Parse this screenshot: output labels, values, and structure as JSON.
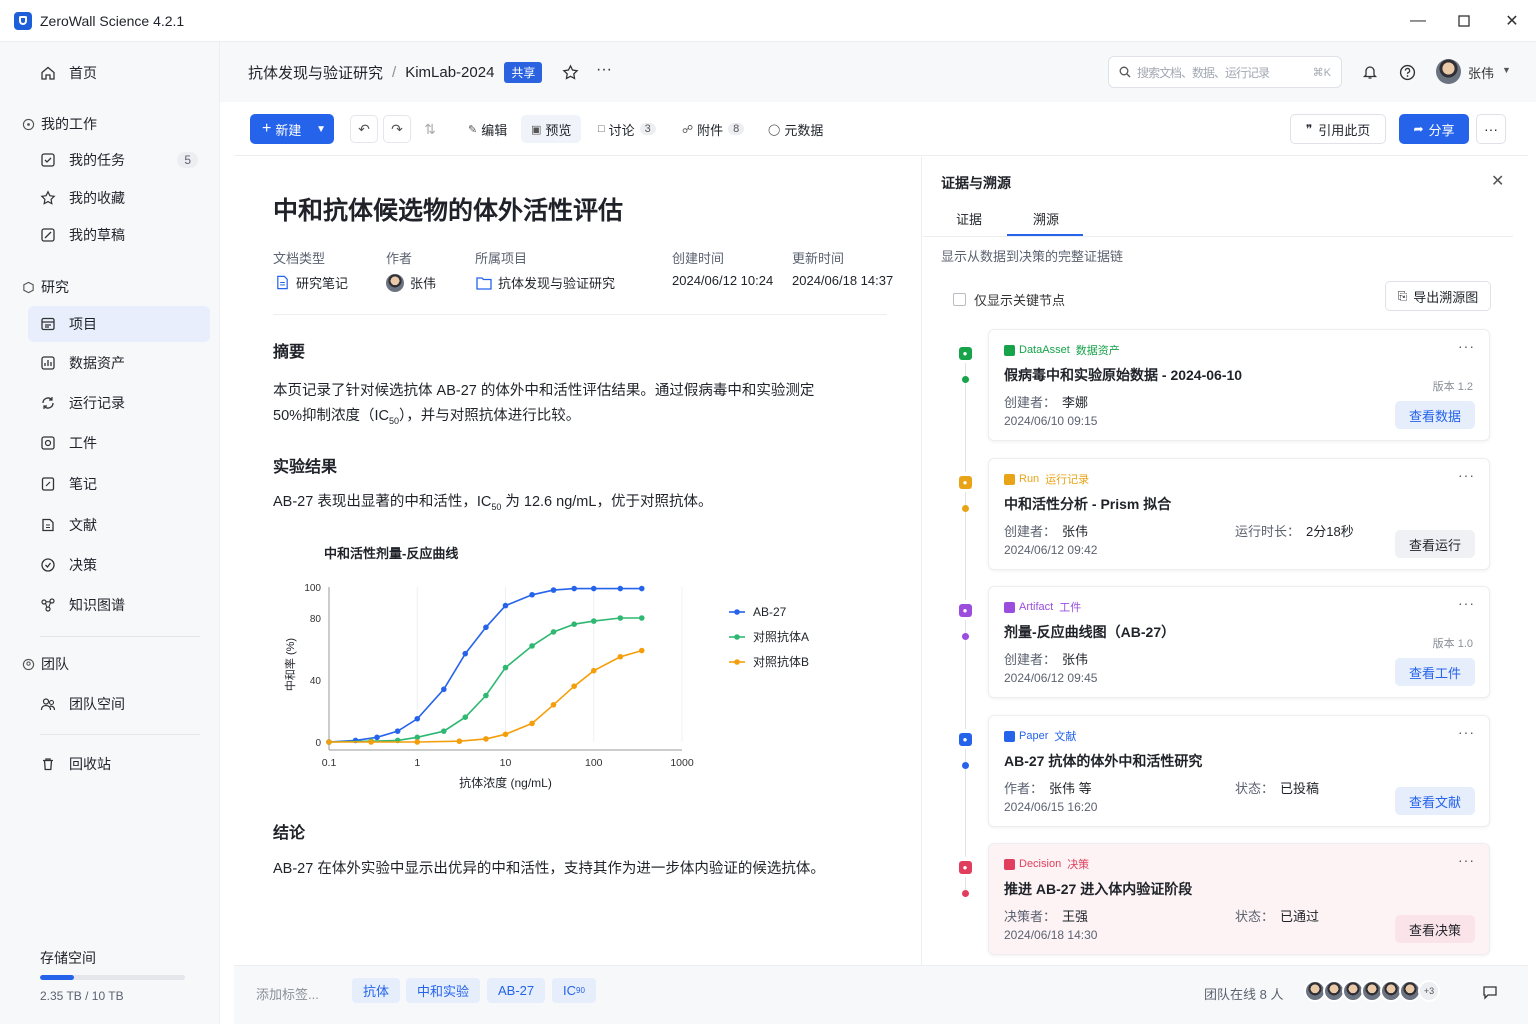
{
  "app": {
    "title": "ZeroWall Science 4.2.1"
  },
  "sidebar": {
    "home": "首页",
    "my_work": "我的工作",
    "my_work_items": [
      {
        "label": "我的任务",
        "count": "5"
      },
      {
        "label": "我的收藏"
      },
      {
        "label": "我的草稿"
      }
    ],
    "research": "研究",
    "research_items": [
      {
        "label": "项目"
      },
      {
        "label": "数据资产"
      },
      {
        "label": "运行记录"
      },
      {
        "label": "工件"
      },
      {
        "label": "笔记"
      },
      {
        "label": "文献"
      },
      {
        "label": "决策"
      },
      {
        "label": "知识图谱"
      }
    ],
    "team": "团队",
    "team_space": "团队空间",
    "trash": "回收站",
    "storage": {
      "label": "存储空间",
      "used_fraction": 0.235,
      "text": "2.35 TB / 10 TB"
    }
  },
  "header": {
    "project": "抗体发现与验证研究",
    "separator": "/",
    "lab": "KimLab-2024",
    "shared_badge": "共享",
    "search_placeholder": "搜索文档、数据、运行记录",
    "search_shortcut": "⌘K",
    "user": "张伟"
  },
  "toolbar": {
    "new_label": "新建",
    "tabs": [
      {
        "label": "编辑"
      },
      {
        "label": "预览"
      },
      {
        "label": "讨论",
        "count": "3"
      },
      {
        "label": "附件",
        "count": "8"
      },
      {
        "label": "元数据"
      }
    ],
    "cite_label": "引用此页",
    "share_label": "分享"
  },
  "doc": {
    "title": "中和抗体候选物的体外活性评估",
    "meta": {
      "type_label": "文档类型",
      "type_value": "研究笔记",
      "author_label": "作者",
      "author_value": "张伟",
      "project_label": "所属项目",
      "project_value": "抗体发现与验证研究",
      "created_label": "创建时间",
      "created_value": "2024/06/12 10:24",
      "updated_label": "更新时间",
      "updated_value": "2024/06/18 14:37"
    },
    "abstract_heading": "摘要",
    "abstract_p1": "本页记录了针对候选抗体 AB-27 的体外中和活性评估结果。通过假病毒中和实验测定",
    "abstract_p2_a": "50%抑制浓度（IC",
    "abstract_p2_sub": "50",
    "abstract_p2_b": "），并与对照抗体进行比较。",
    "results_heading": "实验结果",
    "results_a": "AB-27 表现出显著的中和活性，IC",
    "results_sub": "50",
    "results_b": " 为 12.6 ng/mL，优于对照抗体。",
    "conclusion_heading": "结论",
    "conclusion_text": "AB-27 在体外实验中显示出优异的中和活性，支持其作为进一步体内验证的候选抗体。"
  },
  "chart_data": {
    "type": "line",
    "title": "中和活性剂量-反应曲线",
    "xlabel": "抗体浓度 (ng/mL)",
    "ylabel": "中和率 (%)",
    "x_scale": "log",
    "xlim": [
      0.1,
      1000
    ],
    "ylim": [
      0,
      100
    ],
    "x_ticks": [
      "0.1",
      "1",
      "10",
      "100",
      "1000"
    ],
    "y_ticks": [
      "0",
      "40",
      "80",
      "100"
    ],
    "legend_position": "right",
    "grid": true,
    "series": [
      {
        "name": "AB-27",
        "color": "#2563eb",
        "x": [
          0.1,
          0.2,
          0.35,
          0.6,
          1,
          2,
          3.5,
          6,
          10,
          20,
          35,
          60,
          100,
          200,
          350
        ],
        "y": [
          0,
          1,
          3,
          7,
          15,
          34,
          57,
          74,
          88,
          95,
          98,
          99,
          99,
          99,
          99
        ]
      },
      {
        "name": "对照抗体A",
        "color": "#2eb872",
        "x": [
          0.1,
          0.3,
          0.6,
          1,
          2,
          3.5,
          6,
          10,
          20,
          35,
          60,
          100,
          200,
          350
        ],
        "y": [
          0,
          0.5,
          1,
          3,
          7,
          16,
          30,
          48,
          62,
          71,
          76,
          78,
          80,
          80
        ]
      },
      {
        "name": "对照抗体B",
        "color": "#f59e0b",
        "x": [
          0.1,
          0.3,
          1,
          3,
          6,
          10,
          20,
          35,
          60,
          100,
          200,
          350
        ],
        "y": [
          0,
          0,
          0,
          0.5,
          2,
          5,
          12,
          24,
          36,
          46,
          55,
          59
        ]
      }
    ]
  },
  "tags": {
    "add_placeholder": "添加标签...",
    "items": [
      "抗体",
      "中和实验",
      "AB-27"
    ],
    "ic_tag": "IC",
    "ic_sub": "90"
  },
  "footer": {
    "online": "团队在线 8 人",
    "more_avatars": "+3"
  },
  "panel": {
    "title": "证据与溯源",
    "tabs": [
      "证据",
      "溯源"
    ],
    "description": "显示从数据到决策的完整证据链",
    "checkbox_label": "仅显示关键节点",
    "export_label": "导出溯源图",
    "cards": [
      {
        "type": "DataAsset",
        "type_cn": "数据资产",
        "color": "#16a34a",
        "title": "假病毒中和实验原始数据 - 2024-06-10",
        "l1_label": "创建者：",
        "l1_value": "李娜",
        "date": "2024/06/10 09:15",
        "version": "版本 1.2",
        "button": "查看数据",
        "btn_style": "blue"
      },
      {
        "type": "Run",
        "type_cn": "运行记录",
        "color": "#e8a317",
        "title": "中和活性分析 - Prism 拟合",
        "l1_label": "创建者：",
        "l1_value": "张伟",
        "l2_label": "运行时长：",
        "l2_value": "2分18秒",
        "date": "2024/06/12 09:42",
        "button": "查看运行",
        "btn_style": "grey"
      },
      {
        "type": "Artifact",
        "type_cn": "工件",
        "color": "#9b4dde",
        "title": "剂量-反应曲线图（AB-27）",
        "l1_label": "创建者：",
        "l1_value": "张伟",
        "date": "2024/06/12 09:45",
        "version": "版本 1.0",
        "button": "查看工件",
        "btn_style": "blue"
      },
      {
        "type": "Paper",
        "type_cn": "文献",
        "color": "#2563eb",
        "title": "AB-27 抗体的体外中和活性研究",
        "l1_label": "作者：",
        "l1_value": "张伟 等",
        "l2_label": "状态：",
        "l2_value": "已投稿",
        "date": "2024/06/15 16:20",
        "button": "查看文献",
        "btn_style": "blue"
      },
      {
        "type": "Decision",
        "type_cn": "决策",
        "color": "#e03e5c",
        "title": "推进 AB-27 进入体内验证阶段",
        "l1_label": "决策者：",
        "l1_value": "王强",
        "l2_label": "状态：",
        "l2_value": "已通过",
        "date": "2024/06/18 14:30",
        "button": "查看决策",
        "btn_style": "pink"
      }
    ]
  }
}
